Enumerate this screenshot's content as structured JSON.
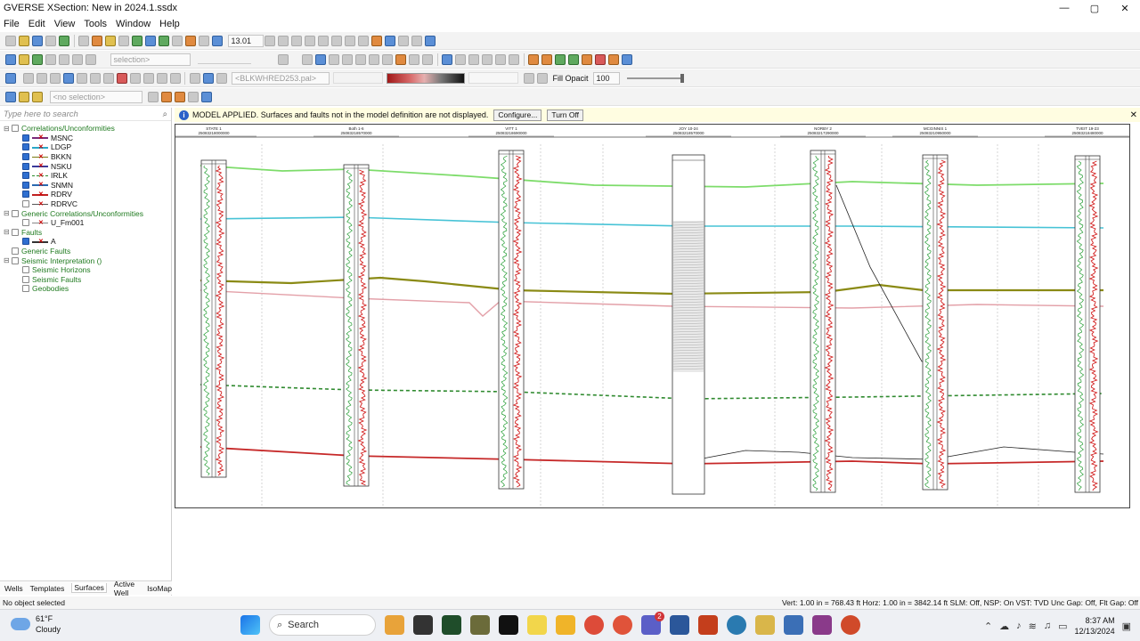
{
  "window": {
    "title": "GVERSE XSection: New in 2024.1.ssdx",
    "minimize": "—",
    "maximize": "▢",
    "close": "✕"
  },
  "menu": [
    "File",
    "Edit",
    "View",
    "Tools",
    "Window",
    "Help"
  ],
  "toolbar1": {
    "zoom_value": "13.01"
  },
  "toolbar2": {
    "selection_placeholder": "selection>"
  },
  "toolbar3": {
    "palette": "<BLKWHRED253.pal>",
    "fill_opacity_label": "Fill Opacit",
    "fill_opacity_value": "100"
  },
  "toolbar4": {
    "selection_placeholder": "<no selection>"
  },
  "search": {
    "placeholder": "Type here to search"
  },
  "tree": [
    {
      "label": "Correlations/Unconformities",
      "level": 0,
      "checked": false,
      "expander": "⊟",
      "group": true
    },
    {
      "label": "MSNC",
      "level": 1,
      "checked": true,
      "color": "#7a2a7a",
      "dash": false
    },
    {
      "label": "LDGP",
      "level": 1,
      "checked": true,
      "color": "#2aa8c8",
      "dash": false
    },
    {
      "label": "BKKN",
      "level": 1,
      "checked": true,
      "color": "#7a7a10",
      "dash": false
    },
    {
      "label": "NSKU",
      "level": 1,
      "checked": true,
      "color": "#3a3a9a",
      "dash": false
    },
    {
      "label": "IRLK",
      "level": 1,
      "checked": true,
      "color": "#2a8a2a",
      "dash": true
    },
    {
      "label": "SNMN",
      "level": 1,
      "checked": true,
      "color": "#2a6ab0",
      "dash": false
    },
    {
      "label": "RDRV",
      "level": 1,
      "checked": true,
      "color": "#c02020",
      "dash": false
    },
    {
      "label": "RDRVC",
      "level": 1,
      "checked": false,
      "color": "#555555",
      "dash": false
    },
    {
      "label": "Generic Correlations/Unconformities",
      "level": 0,
      "checked": false,
      "expander": "⊟",
      "group": true
    },
    {
      "label": "U_Fm001",
      "level": 1,
      "checked": false,
      "color": "#888888",
      "dash": false
    },
    {
      "label": "Faults",
      "level": 0,
      "checked": false,
      "expander": "⊟",
      "group": true
    },
    {
      "label": "A",
      "level": 1,
      "checked": true,
      "color": "#333333",
      "dash": false
    },
    {
      "label": "Generic Faults",
      "level": 0,
      "checked": false,
      "expander": "",
      "group": true
    },
    {
      "label": "Seismic Interpretation ()",
      "level": 0,
      "checked": false,
      "expander": "⊟",
      "group": true
    },
    {
      "label": "Seismic Horizons",
      "level": 1,
      "checked": false,
      "group": true
    },
    {
      "label": "Seismic Faults",
      "level": 1,
      "checked": false,
      "group": true
    },
    {
      "label": "Geobodies",
      "level": 1,
      "checked": false,
      "group": true
    }
  ],
  "bottom_tabs": [
    "Wells",
    "Templates",
    "Surfaces",
    "Active Well",
    "IsoMap"
  ],
  "active_tab": "Surfaces",
  "infobar": {
    "icon": "i",
    "message": "MODEL APPLIED. Surfaces and faults not in the model definition are not displayed.",
    "configure": "Configure...",
    "turn_off": "Turn Off",
    "close": "✕"
  },
  "wells": [
    {
      "name": "STATE 1",
      "uwi": "25083218000000"
    },
    {
      "name": "Both 1-6",
      "uwi": "25083218570000"
    },
    {
      "name": "VITT 1",
      "uwi": "25083218690000"
    },
    {
      "name": "JOY 10-24",
      "uwi": "25083218570000"
    },
    {
      "name": "NORBY 2",
      "uwi": "25083217290000"
    },
    {
      "name": "MCGINNIS 1",
      "uwi": "25083210950000"
    },
    {
      "name": "TVEIT 19-23",
      "uwi": "25083218480000"
    }
  ],
  "statusbar": {
    "left": "No object selected",
    "right": "Vert: 1.00 in = 768.43 ft    Horz: 1.00 in = 3842.14 ft    SLM: Off, NSP: On    VST: TVD    Unc Gap: Off, Flt Gap: Off"
  },
  "taskbar": {
    "temp": "61°F",
    "condition": "Cloudy",
    "search": "Search",
    "time": "8:37 AM",
    "date": "12/13/2024",
    "badge": "2"
  }
}
